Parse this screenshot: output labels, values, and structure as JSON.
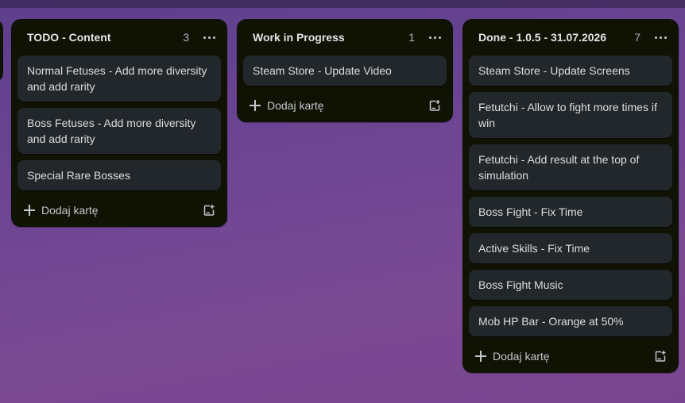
{
  "board": {
    "lists": [
      {
        "title": "TODO - Content",
        "count": "3",
        "cards": [
          "Normal Fetuses - Add more diversity and add rarity",
          "Boss Fetuses - Add more diversity and add rarity",
          "Special Rare Bosses"
        ],
        "add_label": "Dodaj kartę"
      },
      {
        "title": "Work in Progress",
        "count": "1",
        "cards": [
          "Steam Store - Update Video"
        ],
        "add_label": "Dodaj kartę"
      },
      {
        "title": "Done - 1.0.5 - 31.07.2026",
        "count": "7",
        "cards": [
          "Steam Store - Update Screens",
          "Fetutchi - Allow to fight more times if win",
          "Fetutchi - Add result at the top of simulation",
          "Boss Fight - Fix Time",
          "Active Skills - Fix Time",
          "Boss Fight Music",
          "Mob HP Bar - Orange at 50%"
        ],
        "add_label": "Dodaj kartę"
      }
    ]
  },
  "icons": {
    "list_menu": "more-horizontal-icon",
    "add": "plus-icon",
    "template": "card-template-icon"
  },
  "colors": {
    "list_bg": "#101204",
    "card_bg": "#22272b",
    "board_bg": "#6d4593"
  }
}
